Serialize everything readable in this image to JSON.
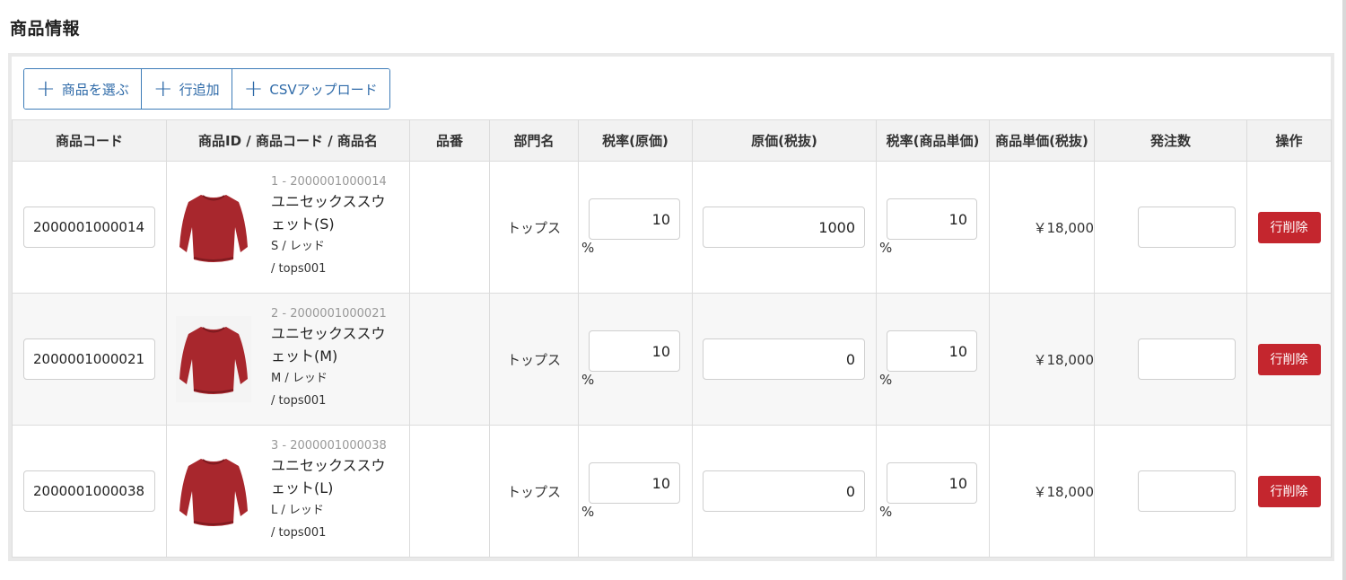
{
  "section_title": "商品情報",
  "toolbar": {
    "select_products": "商品を選ぶ",
    "add_row": "行追加",
    "csv_upload": "CSVアップロード"
  },
  "columns": [
    "商品コード",
    "商品ID / 商品コード / 商品名",
    "品番",
    "部門名",
    "税率(原価)",
    "原価(税抜)",
    "税率(商品単価)",
    "商品単価(税抜)",
    "発注数",
    "操作"
  ],
  "rows": [
    {
      "code": "2000001000014",
      "id_line": "1 - 2000001000014",
      "name": "ユニセックススウェット(S)",
      "variant": "S / レッド",
      "sku": "/ tops001",
      "part_no": "",
      "department": "トップス",
      "tax_cost": "10",
      "cost": "1000",
      "tax_price": "10",
      "unit_price": "￥18,000",
      "order_qty": "",
      "delete_label": "行削除"
    },
    {
      "code": "2000001000021",
      "id_line": "2 - 2000001000021",
      "name": "ユニセックススウェット(M)",
      "variant": "M / レッド",
      "sku": "/ tops001",
      "part_no": "",
      "department": "トップス",
      "tax_cost": "10",
      "cost": "0",
      "tax_price": "10",
      "unit_price": "￥18,000",
      "order_qty": "",
      "delete_label": "行削除"
    },
    {
      "code": "2000001000038",
      "id_line": "3 - 2000001000038",
      "name": "ユニセックススウェット(L)",
      "variant": "L / レッド",
      "sku": "/ tops001",
      "part_no": "",
      "department": "トップス",
      "tax_cost": "10",
      "cost": "0",
      "tax_price": "10",
      "unit_price": "￥18,000",
      "order_qty": "",
      "delete_label": "行削除"
    }
  ],
  "percent_sign": "%",
  "colors": {
    "accent": "#2e6aa8",
    "danger": "#c4262e",
    "sweater": "#a8272d"
  },
  "icons": {
    "toolbar_plus": "plus-icon",
    "thumbnail": "red-sweater-image"
  }
}
